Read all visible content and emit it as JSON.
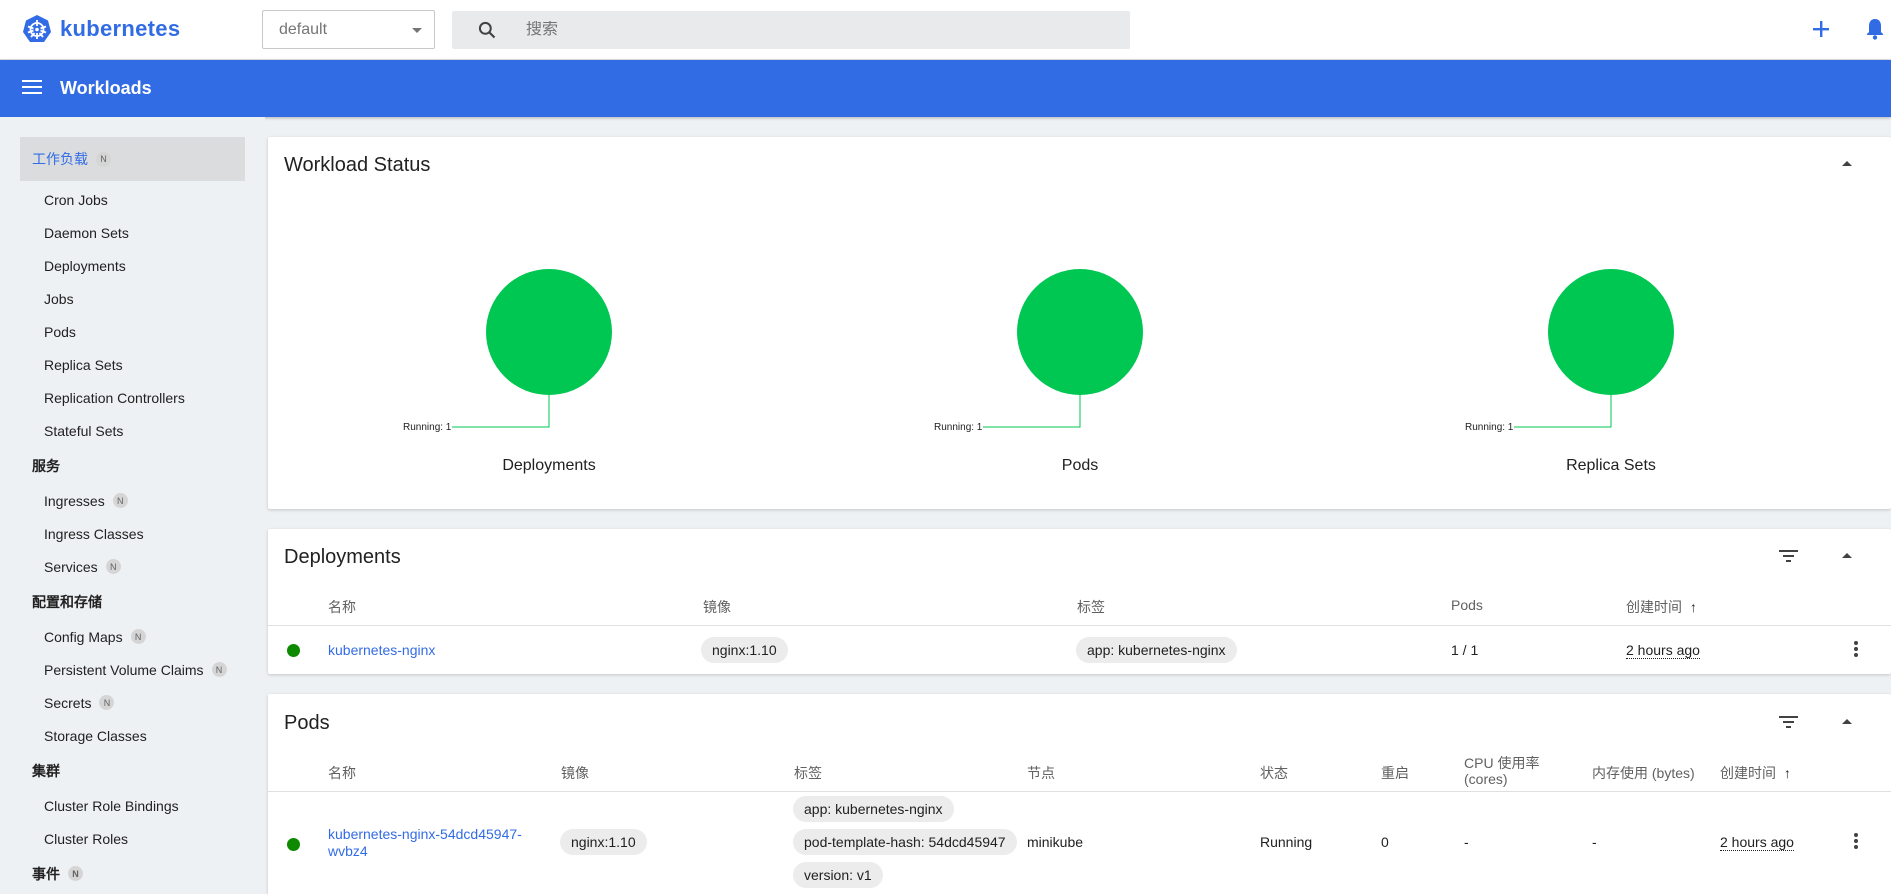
{
  "brand": {
    "name": "kubernetes"
  },
  "namespace": {
    "value": "default"
  },
  "search": {
    "placeholder": "搜索"
  },
  "header": {
    "title": "Workloads"
  },
  "sidebar": {
    "group": "工作负载",
    "group_badge": "N",
    "workloads": [
      "Cron Jobs",
      "Daemon Sets",
      "Deployments",
      "Jobs",
      "Pods",
      "Replica Sets",
      "Replication Controllers",
      "Stateful Sets"
    ],
    "services_title": "服务",
    "services": [
      {
        "label": "Ingresses",
        "badge": "N"
      },
      {
        "label": "Ingress Classes",
        "badge": ""
      },
      {
        "label": "Services",
        "badge": "N"
      }
    ],
    "config_title": "配置和存储",
    "config": [
      {
        "label": "Config Maps",
        "badge": "N"
      },
      {
        "label": "Persistent Volume Claims",
        "badge": "N"
      },
      {
        "label": "Secrets",
        "badge": "N"
      },
      {
        "label": "Storage Classes",
        "badge": ""
      }
    ],
    "cluster_title": "集群",
    "cluster": [
      "Cluster Role Bindings",
      "Cluster Roles"
    ],
    "events_title": "事件",
    "events_badge": "N"
  },
  "status_card": {
    "title": "Workload Status",
    "charts": [
      {
        "name": "Deployments",
        "legend": "Running: 1",
        "running": 1,
        "total": 1
      },
      {
        "name": "Pods",
        "legend": "Running: 1",
        "running": 1,
        "total": 1
      },
      {
        "name": "Replica Sets",
        "legend": "Running: 1",
        "running": 1,
        "total": 1
      }
    ]
  },
  "deployments_card": {
    "title": "Deployments",
    "columns": [
      "名称",
      "镜像",
      "标签",
      "Pods",
      "创建时间"
    ],
    "sort_arrow": "↑",
    "rows": [
      {
        "name": "kubernetes-nginx",
        "image": "nginx:1.10",
        "labels": [
          "app: kubernetes-nginx"
        ],
        "pods": "1 / 1",
        "created": "2 hours ago"
      }
    ]
  },
  "pods_card": {
    "title": "Pods",
    "columns": [
      "名称",
      "镜像",
      "标签",
      "节点",
      "状态",
      "重启",
      "CPU 使用率",
      "(cores)",
      "内存使用 (bytes)",
      "创建时间"
    ],
    "sort_arrow": "↑",
    "rows": [
      {
        "name_line1": "kubernetes-nginx-54dcd45947-",
        "name_line2": "wvbz4",
        "image": "nginx:1.10",
        "labels": [
          "app: kubernetes-nginx",
          "pod-template-hash: 54dcd45947",
          "version: v1"
        ],
        "node": "minikube",
        "status": "Running",
        "restarts": "0",
        "cpu": "-",
        "memory": "-",
        "created": "2 hours ago"
      }
    ]
  },
  "colors": {
    "accent": "#326ce5",
    "running": "#00c752",
    "ok_dot": "#0d8a00"
  }
}
